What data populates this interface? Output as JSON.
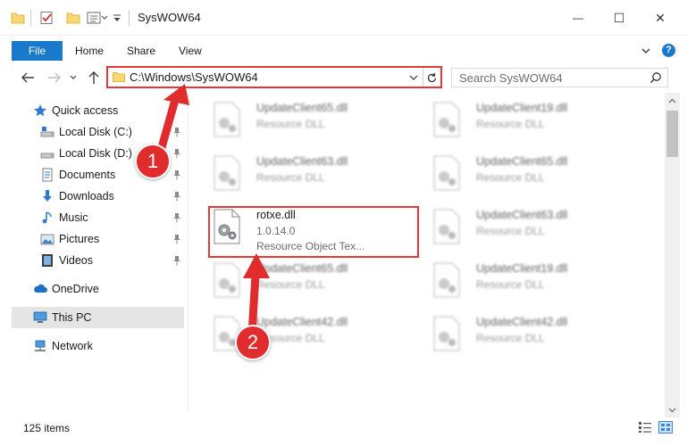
{
  "window": {
    "title": "SysWOW64",
    "minimize_glyph": "—",
    "maximize_glyph": "☐",
    "close_glyph": "✕"
  },
  "ribbon": {
    "tabs": [
      "File",
      "Home",
      "Share",
      "View"
    ],
    "help": "?"
  },
  "nav": {
    "address": "C:\\Windows\\SysWOW64",
    "search_placeholder": "Search SysWOW64"
  },
  "sidebar": {
    "items": [
      {
        "label": "Quick access",
        "icon": "star-icon"
      },
      {
        "label": "Local Disk (C:)",
        "icon": "drive-icon",
        "pinned": true
      },
      {
        "label": "Local Disk (D:)",
        "icon": "drive-icon",
        "pinned": true
      },
      {
        "label": "Documents",
        "icon": "documents-icon",
        "pinned": true
      },
      {
        "label": "Downloads",
        "icon": "download-icon",
        "pinned": true
      },
      {
        "label": "Music",
        "icon": "music-icon",
        "pinned": true
      },
      {
        "label": "Pictures",
        "icon": "pictures-icon",
        "pinned": true
      },
      {
        "label": "Videos",
        "icon": "videos-icon",
        "pinned": true
      },
      {
        "label": "OneDrive",
        "icon": "cloud-icon"
      },
      {
        "label": "This PC",
        "icon": "computer-icon",
        "selected": true
      },
      {
        "label": "Network",
        "icon": "network-icon"
      }
    ]
  },
  "files": [
    {
      "name": "UpdateClient65.dll",
      "desc": "Resource DLL"
    },
    {
      "name": "UpdateClient19.dll",
      "desc": "Resource DLL"
    },
    {
      "name": "UpdateClient63.dll",
      "desc": "Resource DLL"
    },
    {
      "name": "UpdateClient65.dll",
      "desc": "Resource DLL"
    },
    {
      "name": "rotxe.dll",
      "version": "1.0.14.0",
      "desc": "Resource Object Tex..."
    },
    {
      "name": "UpdateClient63.dll",
      "desc": "Resource DLL"
    },
    {
      "name": "UpdateClient65.dll",
      "desc": "Resource DLL"
    },
    {
      "name": "UpdateClient19.dll",
      "desc": "Resource DLL"
    },
    {
      "name": "UpdateClient42.dll",
      "desc": "Resource DLL"
    },
    {
      "name": "UpdateClient42.dll",
      "desc": "Resource DLL"
    }
  ],
  "status": {
    "item_count": "125 items"
  },
  "annotations": {
    "step1": "1",
    "step2": "2",
    "color": "#e02c2c"
  }
}
